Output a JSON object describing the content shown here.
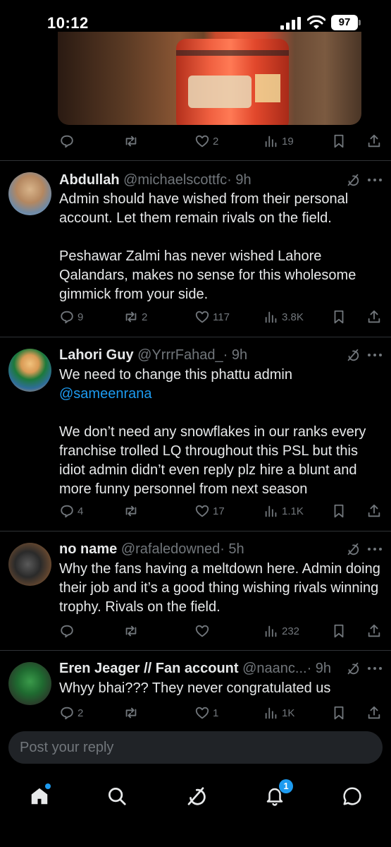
{
  "status_bar": {
    "time": "10:12",
    "battery": "97"
  },
  "top_post": {
    "actions": {
      "replies": "",
      "reposts": "",
      "likes": "2",
      "views": "19"
    }
  },
  "replies": [
    {
      "name": "Abdullah",
      "handle": "@michaelscottfc",
      "time": "· 9h",
      "paragraphs": [
        "Admin should have wished from their personal account. Let them remain rivals on the field.",
        "Peshawar Zalmi has never wished Lahore Qalandars, makes no sense for this wholesome gimmick from your side."
      ],
      "replies": "9",
      "reposts": "2",
      "likes": "117",
      "views": "3.8K"
    },
    {
      "name": "Lahori Guy",
      "handle": "@YrrrFahad_",
      "time": "· 9h",
      "line1": "We need to change this phattu admin",
      "mention": "@sameenrana",
      "paragraph2": "We don’t need any snowflakes in our ranks every franchise trolled LQ throughout this PSL but this idiot admin didn’t even reply plz hire a blunt and more funny personnel from next season",
      "replies": "4",
      "reposts": "",
      "likes": "17",
      "views": "1.1K"
    },
    {
      "name": "no name",
      "handle": "@rafaledowned",
      "time": "· 5h",
      "paragraphs": [
        "Why the fans having a meltdown here. Admin doing their job and it’s a good thing wishing rivals winning trophy. Rivals on the field."
      ],
      "replies": "",
      "reposts": "",
      "likes": "",
      "views": "232"
    },
    {
      "name": "Eren Jeager // Fan account",
      "handle": "@naanc...",
      "time": "· 9h",
      "paragraphs": [
        "Whyy bhai??? They never congratulated us"
      ],
      "replies": "2",
      "reposts": "",
      "likes": "1",
      "views": "1K"
    }
  ],
  "reply_box": {
    "placeholder": "Post your reply"
  },
  "bottom_nav": {
    "items": [
      "home-icon",
      "search-icon",
      "grok-icon",
      "notifications-icon",
      "messages-icon"
    ],
    "notifications_badge": "1"
  },
  "colors": {
    "background": "#000000",
    "text": "#e7e9ea",
    "muted": "#71767b",
    "accent": "#1d9bf0",
    "divider": "#2f3336"
  }
}
